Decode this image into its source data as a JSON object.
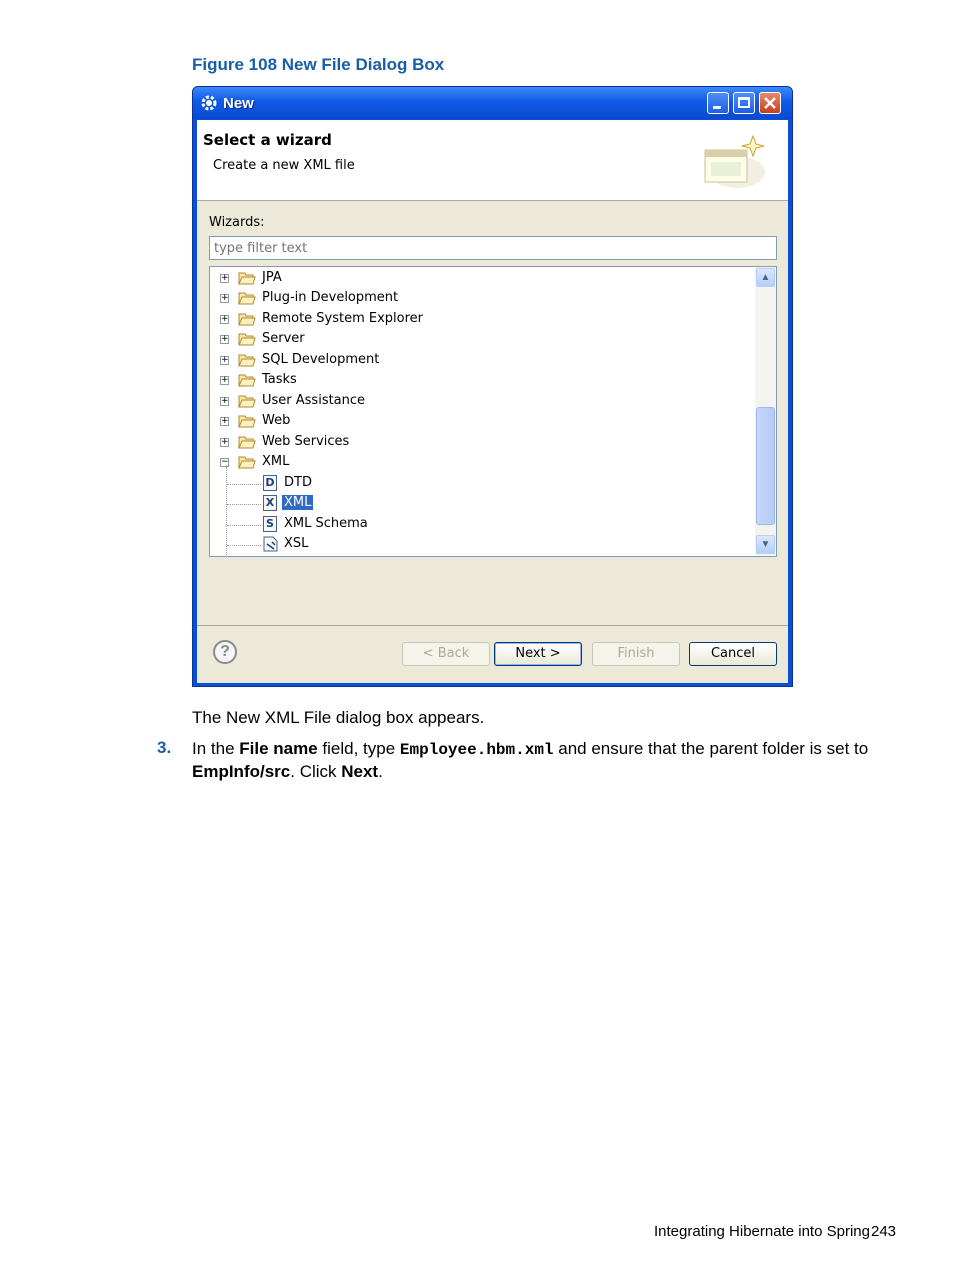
{
  "figure": {
    "caption": "Figure 108 New File Dialog Box"
  },
  "dialog": {
    "title": "New",
    "header": {
      "title": "Select a wizard",
      "description": "Create a new XML file"
    },
    "wizards_label": "Wizards:",
    "filter": {
      "placeholder": "type filter text",
      "value": ""
    },
    "tree": {
      "folders": [
        {
          "label": "JPA",
          "expanded": false
        },
        {
          "label": "Plug-in Development",
          "expanded": false
        },
        {
          "label": "Remote System Explorer",
          "expanded": false
        },
        {
          "label": "Server",
          "expanded": false
        },
        {
          "label": "SQL Development",
          "expanded": false
        },
        {
          "label": "Tasks",
          "expanded": false
        },
        {
          "label": "User Assistance",
          "expanded": false
        },
        {
          "label": "Web",
          "expanded": false
        },
        {
          "label": "Web Services",
          "expanded": false
        },
        {
          "label": "XML",
          "expanded": true
        }
      ],
      "xml_children": [
        {
          "label": "DTD",
          "icon": "D",
          "selected": false
        },
        {
          "label": "XML",
          "icon": "X",
          "selected": true
        },
        {
          "label": "XML Schema",
          "icon": "S",
          "selected": false
        },
        {
          "label": "XSL",
          "icon": "",
          "selected": false
        }
      ]
    },
    "buttons": {
      "back": "< Back",
      "next": "Next >",
      "finish": "Finish",
      "cancel": "Cancel"
    },
    "colors": {
      "titlebar": "#0a4fd6",
      "selection": "#316ac5",
      "client": "#ece9d8"
    }
  },
  "text": {
    "after_figure": "The New XML File dialog box appears.",
    "step": {
      "number": "3.",
      "part1": "In the ",
      "field_name": "File name",
      "part2": " field, type ",
      "file_value": "Employee.hbm.xml",
      "part3": " and ensure that the parent folder is set to ",
      "folder": "EmpInfo/src",
      "part4": ". Click ",
      "next_label": "Next",
      "part5": "."
    }
  },
  "footer": {
    "section": "Integrating Hibernate into Spring",
    "page": "243"
  }
}
